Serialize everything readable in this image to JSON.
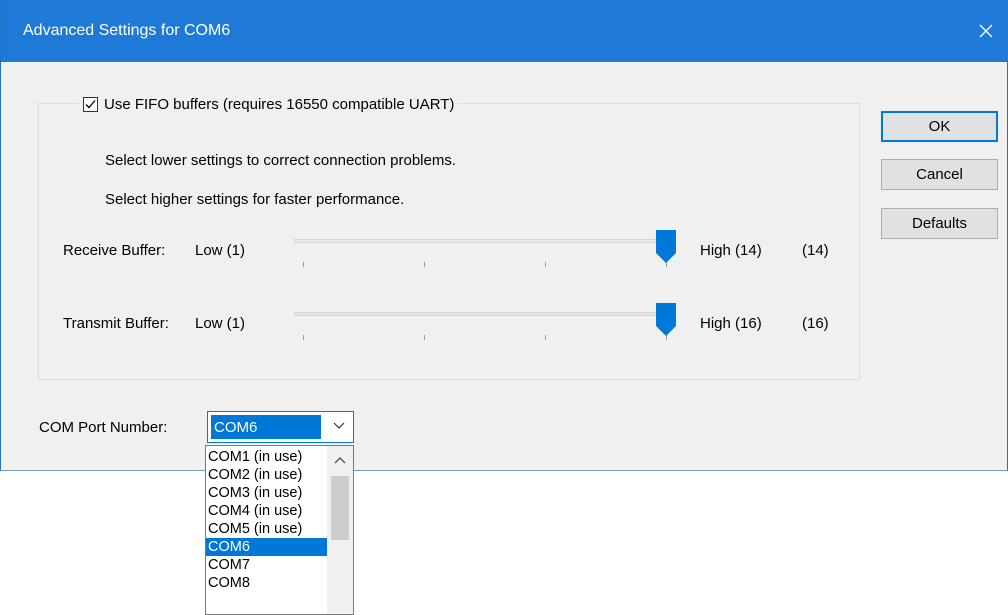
{
  "window": {
    "title": "Advanced Settings for COM6"
  },
  "fifo": {
    "checkbox_label": "Use FIFO buffers (requires 16550 compatible UART)",
    "checked": true,
    "hint_lower": "Select lower settings to correct connection problems.",
    "hint_higher": "Select higher settings for faster performance."
  },
  "receive_buffer": {
    "label": "Receive Buffer:",
    "low_label": "Low (1)",
    "high_label": "High (14)",
    "value_label": "(14)",
    "value": 14,
    "min": 1,
    "max": 14
  },
  "transmit_buffer": {
    "label": "Transmit Buffer:",
    "low_label": "Low (1)",
    "high_label": "High (16)",
    "value_label": "(16)",
    "value": 16,
    "min": 1,
    "max": 16
  },
  "buttons": {
    "ok": "OK",
    "cancel": "Cancel",
    "defaults": "Defaults"
  },
  "com_port": {
    "label": "COM Port Number:",
    "selected": "COM6",
    "options": [
      "COM1 (in use)",
      "COM2 (in use)",
      "COM3 (in use)",
      "COM4 (in use)",
      "COM5 (in use)",
      "COM6",
      "COM7",
      "COM8"
    ],
    "selected_index": 5
  },
  "colors": {
    "title_bar": "#1e7ad6",
    "accent": "#0078d7"
  }
}
